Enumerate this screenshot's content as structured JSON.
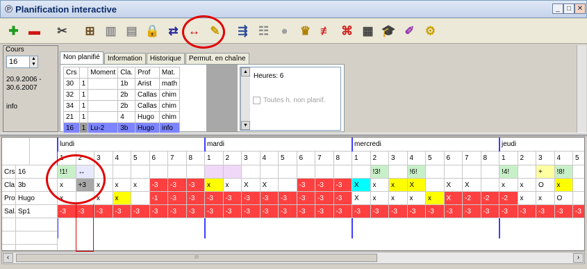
{
  "window": {
    "title": "Planification interactive"
  },
  "toolbar": {
    "buttons": [
      {
        "name": "add-icon",
        "glyph": "✚",
        "color": "#1e9a1e"
      },
      {
        "name": "remove-icon",
        "glyph": "▬",
        "color": "#d01818"
      },
      {
        "name": "cut-icon",
        "glyph": "✂",
        "color": "#404040"
      },
      {
        "name": "delete-lesson-icon",
        "glyph": "⊞",
        "color": "#6a4a20"
      },
      {
        "name": "split-lesson-icon",
        "glyph": "▥",
        "color": "#8a8a8a"
      },
      {
        "name": "note-icon",
        "glyph": "▤",
        "color": "#8a8a8a"
      },
      {
        "name": "lock-icon",
        "glyph": "🔒",
        "color": "#555555"
      },
      {
        "name": "swap-rooms-icon",
        "glyph": "⇄",
        "color": "#2a2a9a"
      },
      {
        "name": "exchange-icon",
        "glyph": "↔",
        "color": "#c00000"
      },
      {
        "name": "move-lesson-icon",
        "glyph": "✎",
        "color": "#c8a000"
      },
      {
        "name": "align-icon",
        "glyph": "⇶",
        "color": "#2a4a9a"
      },
      {
        "name": "table-icon",
        "glyph": "☷",
        "color": "#8a8a8a"
      },
      {
        "name": "circle-icon",
        "glyph": "●",
        "color": "#a0a0a0"
      },
      {
        "name": "teacher-icon",
        "glyph": "♛",
        "color": "#b08000"
      },
      {
        "name": "clear-icon",
        "glyph": "≢",
        "color": "#d01818"
      },
      {
        "name": "delete-all-icon",
        "glyph": "⌘",
        "color": "#d01818"
      },
      {
        "name": "calculator-icon",
        "glyph": "▦",
        "color": "#404040"
      },
      {
        "name": "graduation-cap-icon",
        "glyph": "🎓",
        "color": "#202020"
      },
      {
        "name": "pencil-cup-icon",
        "glyph": "✐",
        "color": "#9a3ab0"
      },
      {
        "name": "gears-icon",
        "glyph": "⚙",
        "color": "#c8a000"
      }
    ]
  },
  "left_panel": {
    "label": "Cours",
    "course_value": "16",
    "date_from": "20.9.2006 -",
    "date_to": "30.6.2007",
    "info": "info"
  },
  "tabs": [
    "Non planifié",
    "Information",
    "Historique",
    "Permut. en chaîne"
  ],
  "course_table": {
    "headers": [
      "Crs",
      "",
      "Moment",
      "Cla.",
      "Prof",
      "Mat."
    ],
    "rows": [
      [
        "30",
        "1",
        "",
        "1b",
        "Arist",
        "math"
      ],
      [
        "32",
        "1",
        "",
        "2b",
        "Callas",
        "chim"
      ],
      [
        "34",
        "1",
        "",
        "2b",
        "Callas",
        "chim"
      ],
      [
        "21",
        "1",
        "",
        "4",
        "Hugo",
        "chim"
      ],
      [
        "16",
        "1",
        "Lu-2",
        "3b",
        "Hugo",
        "info"
      ]
    ]
  },
  "info_panel": {
    "hours": "Heures: 6",
    "checkbox_label": "Toutes h. non planif."
  },
  "grid": {
    "days": [
      "lundi",
      "mardi",
      "mercredi",
      "jeudi"
    ],
    "periods": [
      "1",
      "2",
      "3",
      "4",
      "5",
      "6",
      "7",
      "8"
    ],
    "row_labels": [
      {
        "label": "Crs",
        "value": "16"
      },
      {
        "label": "Cla.",
        "value": "3b"
      },
      {
        "label": "Prof",
        "value": "Hugo"
      },
      {
        "label": "Sal.",
        "value": "Sp1"
      }
    ],
    "rows": [
      [
        "!1!",
        "↔",
        "",
        "",
        "",
        "",
        "",
        "",
        "",
        "",
        "",
        "",
        "",
        "",
        "",
        "",
        "",
        "!3!",
        "",
        "!6!",
        "",
        "",
        "",
        "",
        "!4!",
        "",
        "+",
        "!8!",
        ""
      ],
      [
        "x",
        "+3",
        "x",
        "x",
        "x",
        "-3",
        "-3",
        "-3",
        "x",
        "x",
        "X",
        "X",
        "",
        "-3",
        "-3",
        "-3",
        "X",
        "x",
        "x",
        "X",
        "",
        "X",
        "X",
        "",
        "x",
        "x",
        "O",
        "x",
        ""
      ],
      [
        "x",
        "",
        "x",
        "x",
        "",
        "-1",
        "-3",
        "-3",
        "-3",
        "-3",
        "-3",
        "-3",
        "-3",
        "-3",
        "-3",
        "-3",
        "X",
        "x",
        "x",
        "x",
        "x",
        "X",
        "-2",
        "-2",
        "-2",
        "x",
        "x",
        "O",
        ""
      ],
      [
        "-3",
        "-3",
        "-3",
        "-3",
        "-3",
        "-3",
        "-3",
        "-3",
        "-3",
        "-3",
        "-3",
        "-3",
        "-3",
        "-3",
        "-3",
        "-3",
        "-3",
        "-3",
        "-3",
        "-3",
        "-3",
        "-3",
        "-3",
        "-3",
        "-3",
        "-3",
        "-3",
        "-3",
        "-3"
      ]
    ],
    "colors": [
      [
        "#c8f0c8",
        "#e8e8ff",
        "#ffffff",
        "#ffffff",
        "#ffffff",
        "#ffffff",
        "#ffffff",
        "#ffffff",
        "#f0d8f8",
        "#f0d8f8",
        "#ffffff",
        "#ffffff",
        "#ffffff",
        "#ffffff",
        "#ffffff",
        "#ffffff",
        "#ffffff",
        "#c8f0c8",
        "#ffffff",
        "#c8f0c8",
        "#ffffff",
        "#ffffff",
        "#ffffff",
        "#ffffff",
        "#c8f0c8",
        "#ffffff",
        "#ffffa0",
        "#c8f0c8",
        "#ffffff"
      ],
      [
        "#ffffff",
        "#a8a8a8",
        "#ffffff",
        "#ffffff",
        "#ffffff",
        "#ff4040",
        "#ff4040",
        "#ff4040",
        "#ffff00",
        "#ffffff",
        "#ffffff",
        "#ffffff",
        "#ffffff",
        "#ff4040",
        "#ff4040",
        "#ff4040",
        "#00ffff",
        "#ffffff",
        "#ffff00",
        "#ffff00",
        "#ffffff",
        "#ffffff",
        "#ffffff",
        "#ffffff",
        "#ffffff",
        "#ffffff",
        "#ffffff",
        "#ffff00",
        "#ffffff"
      ],
      [
        "#ffffff",
        "#ffffff",
        "#ffffff",
        "#ffff00",
        "#ffffff",
        "#ff4040",
        "#ff4040",
        "#ff4040",
        "#ff4040",
        "#ff4040",
        "#ff4040",
        "#ff4040",
        "#ff4040",
        "#ff4040",
        "#ff4040",
        "#ff4040",
        "#ffffff",
        "#ffffff",
        "#ffffff",
        "#ffffff",
        "#ffff00",
        "#ff4040",
        "#ff4040",
        "#ff4040",
        "#ff4040",
        "#ffffff",
        "#ffffff",
        "#ffffff",
        "#ffffff"
      ],
      [
        "#ff4040",
        "#ff4040",
        "#ff4040",
        "#ff4040",
        "#ff4040",
        "#ff4040",
        "#ff4040",
        "#ff4040",
        "#ff4040",
        "#ff4040",
        "#ff4040",
        "#ff4040",
        "#ff4040",
        "#ff4040",
        "#ff4040",
        "#ff4040",
        "#ff4040",
        "#ff4040",
        "#ff4040",
        "#ff4040",
        "#ff4040",
        "#ff4040",
        "#ff4040",
        "#ff4040",
        "#ff4040",
        "#ff4040",
        "#ff4040",
        "#ff4040",
        "#ff4040"
      ]
    ]
  },
  "scroll_label": "III",
  "colors": {
    "highlight": "#e00000",
    "day_separator": "#3c3cff",
    "selection": "#7c84ff",
    "conflict": "#ff4040",
    "free": "#ffff00"
  }
}
